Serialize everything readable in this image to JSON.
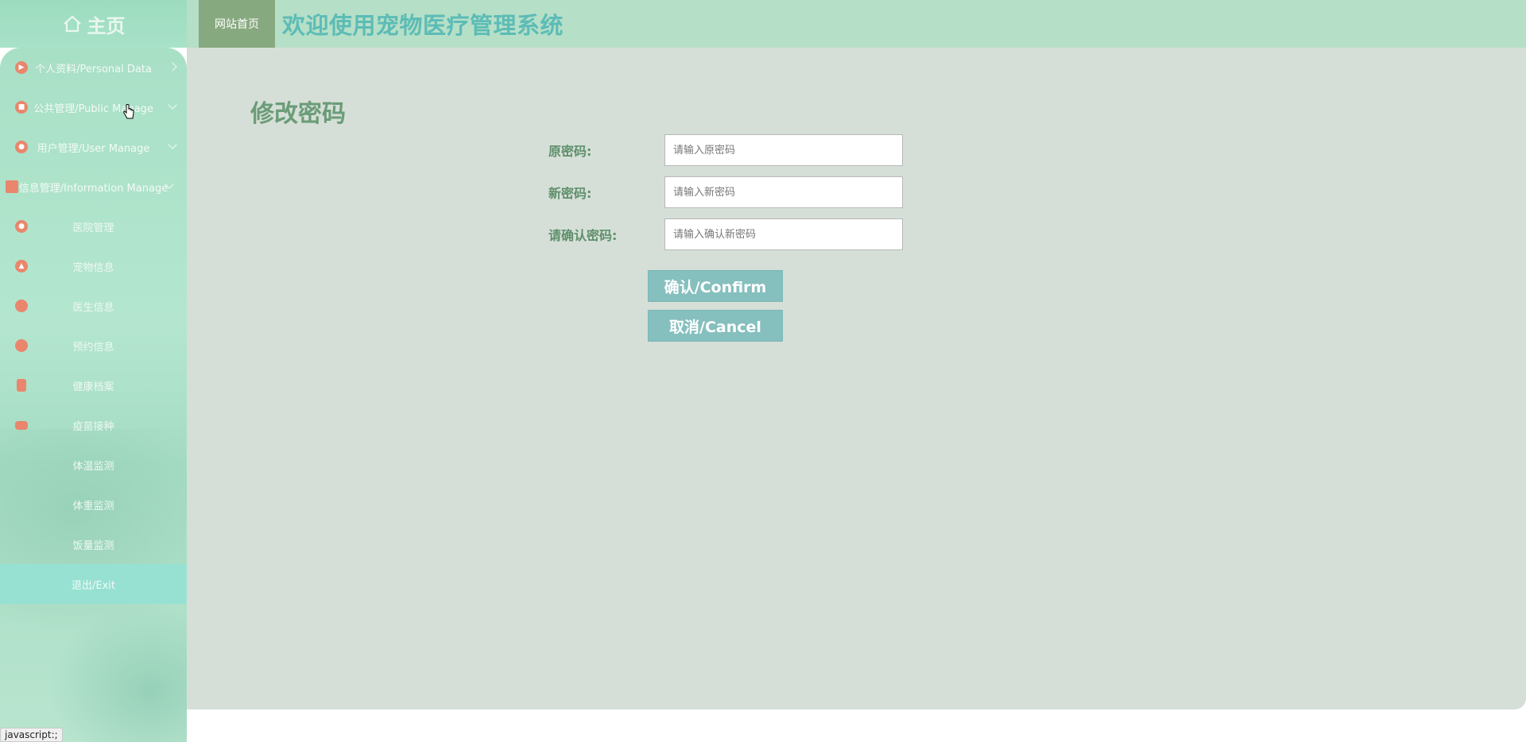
{
  "header": {
    "home_label": "主页",
    "site_home_button": "网站首页",
    "system_title": "欢迎使用宠物医疗管理系统"
  },
  "sidebar": {
    "items": [
      {
        "label": "个人资料/Personal Data",
        "icon": "flag-icon",
        "expandable": true
      },
      {
        "label": "公共管理/Public Manage",
        "icon": "hat-icon",
        "expandable": true
      },
      {
        "label": "用户管理/User Manage",
        "icon": "user-icon",
        "expandable": true
      },
      {
        "label": "信息管理/Information Manage",
        "icon": "book-icon",
        "expandable": true
      }
    ],
    "sub_items": [
      {
        "label": "医院管理",
        "icon": "pin-icon"
      },
      {
        "label": "宠物信息",
        "icon": "arrow-icon"
      },
      {
        "label": "医生信息",
        "icon": "chat-icon"
      },
      {
        "label": "预约信息",
        "icon": "message-icon"
      },
      {
        "label": "健康档案",
        "icon": "file-icon"
      },
      {
        "label": "疫苗接种",
        "icon": "card-icon"
      },
      {
        "label": "体温监测",
        "icon": ""
      },
      {
        "label": "体重监测",
        "icon": ""
      },
      {
        "label": "饭量监测",
        "icon": ""
      }
    ],
    "exit_label": "退出/Exit"
  },
  "main": {
    "page_title": "修改密码",
    "form": {
      "old_password_label": "原密码:",
      "old_password_placeholder": "请输入原密码",
      "new_password_label": "新密码:",
      "new_password_placeholder": "请输入新密码",
      "confirm_password_label": "请确认密码:",
      "confirm_password_placeholder": "请输入确认新密码"
    },
    "confirm_button": "确认/Confirm",
    "cancel_button": "取消/Cancel"
  },
  "status_bar": {
    "link_preview": "javascript:;"
  },
  "colors": {
    "header_bg": "#b6dfc7",
    "title_color": "#5cbcb6",
    "site_home_bg": "#87a97f",
    "main_bg": "#d5dfd7",
    "button_bg": "#85bfbe",
    "active_menu_bg": "#97e1d2",
    "icon_accent": "#e9866d"
  }
}
